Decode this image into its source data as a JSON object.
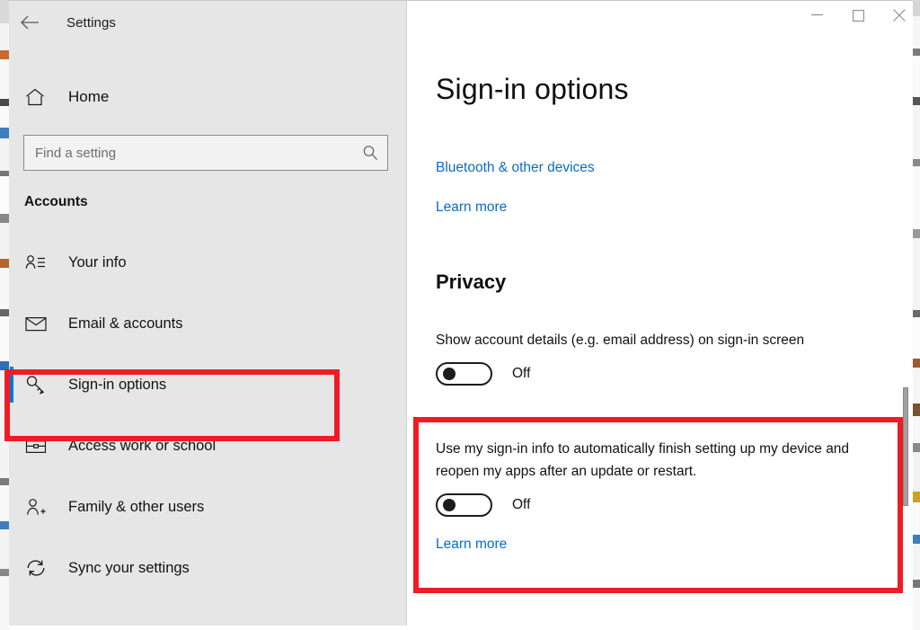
{
  "window": {
    "app_title": "Settings",
    "back_icon": "back-arrow-icon",
    "controls": {
      "minimize": "─",
      "maximize": "□",
      "close": "✕"
    }
  },
  "sidebar": {
    "home": {
      "label": "Home",
      "icon": "home-icon"
    },
    "search": {
      "placeholder": "Find a setting",
      "value": "",
      "icon": "search-icon"
    },
    "section_label": "Accounts",
    "items": [
      {
        "label": "Your info",
        "icon": "user-info-icon",
        "selected": false
      },
      {
        "label": "Email & accounts",
        "icon": "envelope-icon",
        "selected": false
      },
      {
        "label": "Sign-in options",
        "icon": "key-icon",
        "selected": true
      },
      {
        "label": "Access work or school",
        "icon": "briefcase-icon",
        "selected": false
      },
      {
        "label": "Family & other users",
        "icon": "user-add-icon",
        "selected": false
      },
      {
        "label": "Sync your settings",
        "icon": "sync-refresh-icon",
        "selected": false
      }
    ]
  },
  "main": {
    "page_title": "Sign-in options",
    "top_links": [
      {
        "label": "Bluetooth & other devices"
      },
      {
        "label": "Learn more"
      }
    ],
    "privacy": {
      "heading": "Privacy",
      "settings": [
        {
          "description": "Show account details (e.g. email address) on sign-in screen",
          "toggle_state": "Off",
          "highlighted": false
        },
        {
          "description": "Use my sign-in info to automatically finish setting up my device and reopen my apps after an update or restart.",
          "toggle_state": "Off",
          "link_label": "Learn more",
          "highlighted": true
        }
      ]
    }
  },
  "annotations": {
    "highlight_color": "#ee1c25",
    "selection_color": "#0078d7",
    "link_color": "#0a6cc4"
  }
}
